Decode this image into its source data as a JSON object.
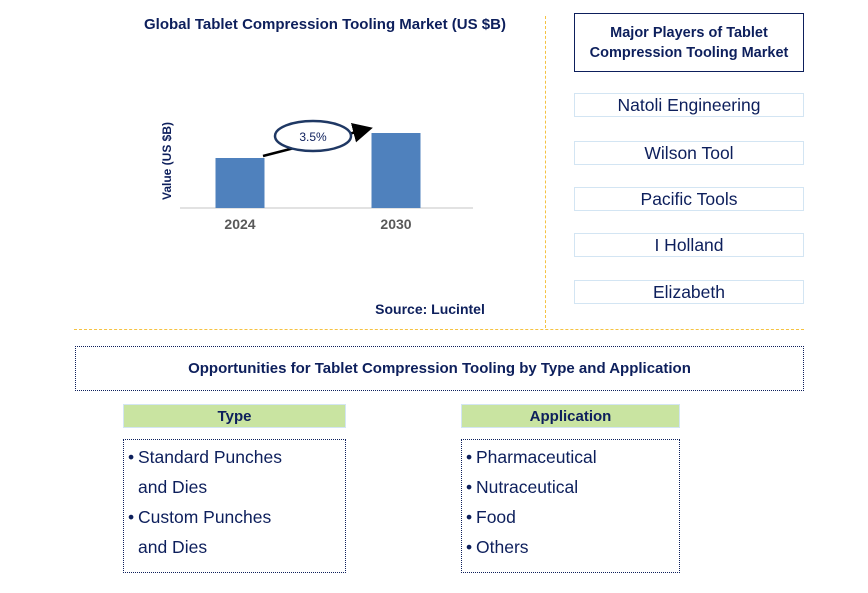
{
  "chart_data": {
    "type": "bar",
    "title": "Global Tablet Compression Tooling Market (US $B)",
    "xlabel": "",
    "ylabel": "Value (US $B)",
    "categories": [
      "2024",
      "2030"
    ],
    "values": [
      1.0,
      1.5
    ],
    "value_note": "No y-axis scale shown; relative bar heights estimated",
    "annotation": {
      "label": "3.5%",
      "type": "CAGR arrow from 2024 to 2030"
    },
    "bar_color": "#4f81bd",
    "grid": false,
    "legend": "none",
    "source": "Source: Lucintel"
  },
  "players": {
    "title": "Major Players of Tablet Compression Tooling Market",
    "items": [
      "Natoli Engineering",
      "Wilson Tool",
      "Pacific Tools",
      "I Holland",
      "Elizabeth"
    ]
  },
  "opportunities": {
    "title": "Opportunities for Tablet Compression Tooling by Type and Application",
    "type": {
      "header": "Type",
      "items": [
        [
          "Standard Punches",
          "and Dies"
        ],
        [
          "Custom Punches",
          "and Dies"
        ]
      ]
    },
    "application": {
      "header": "Application",
      "items": [
        [
          "Pharmaceutical"
        ],
        [
          "Nutraceutical"
        ],
        [
          "Food"
        ],
        [
          "Others"
        ]
      ]
    }
  },
  "colors": {
    "navy": "#0d1f5c",
    "bar": "#4f81bd",
    "divider": "#f5c242",
    "header_green": "#c9e4a1",
    "player_border": "#d3e5f3"
  }
}
